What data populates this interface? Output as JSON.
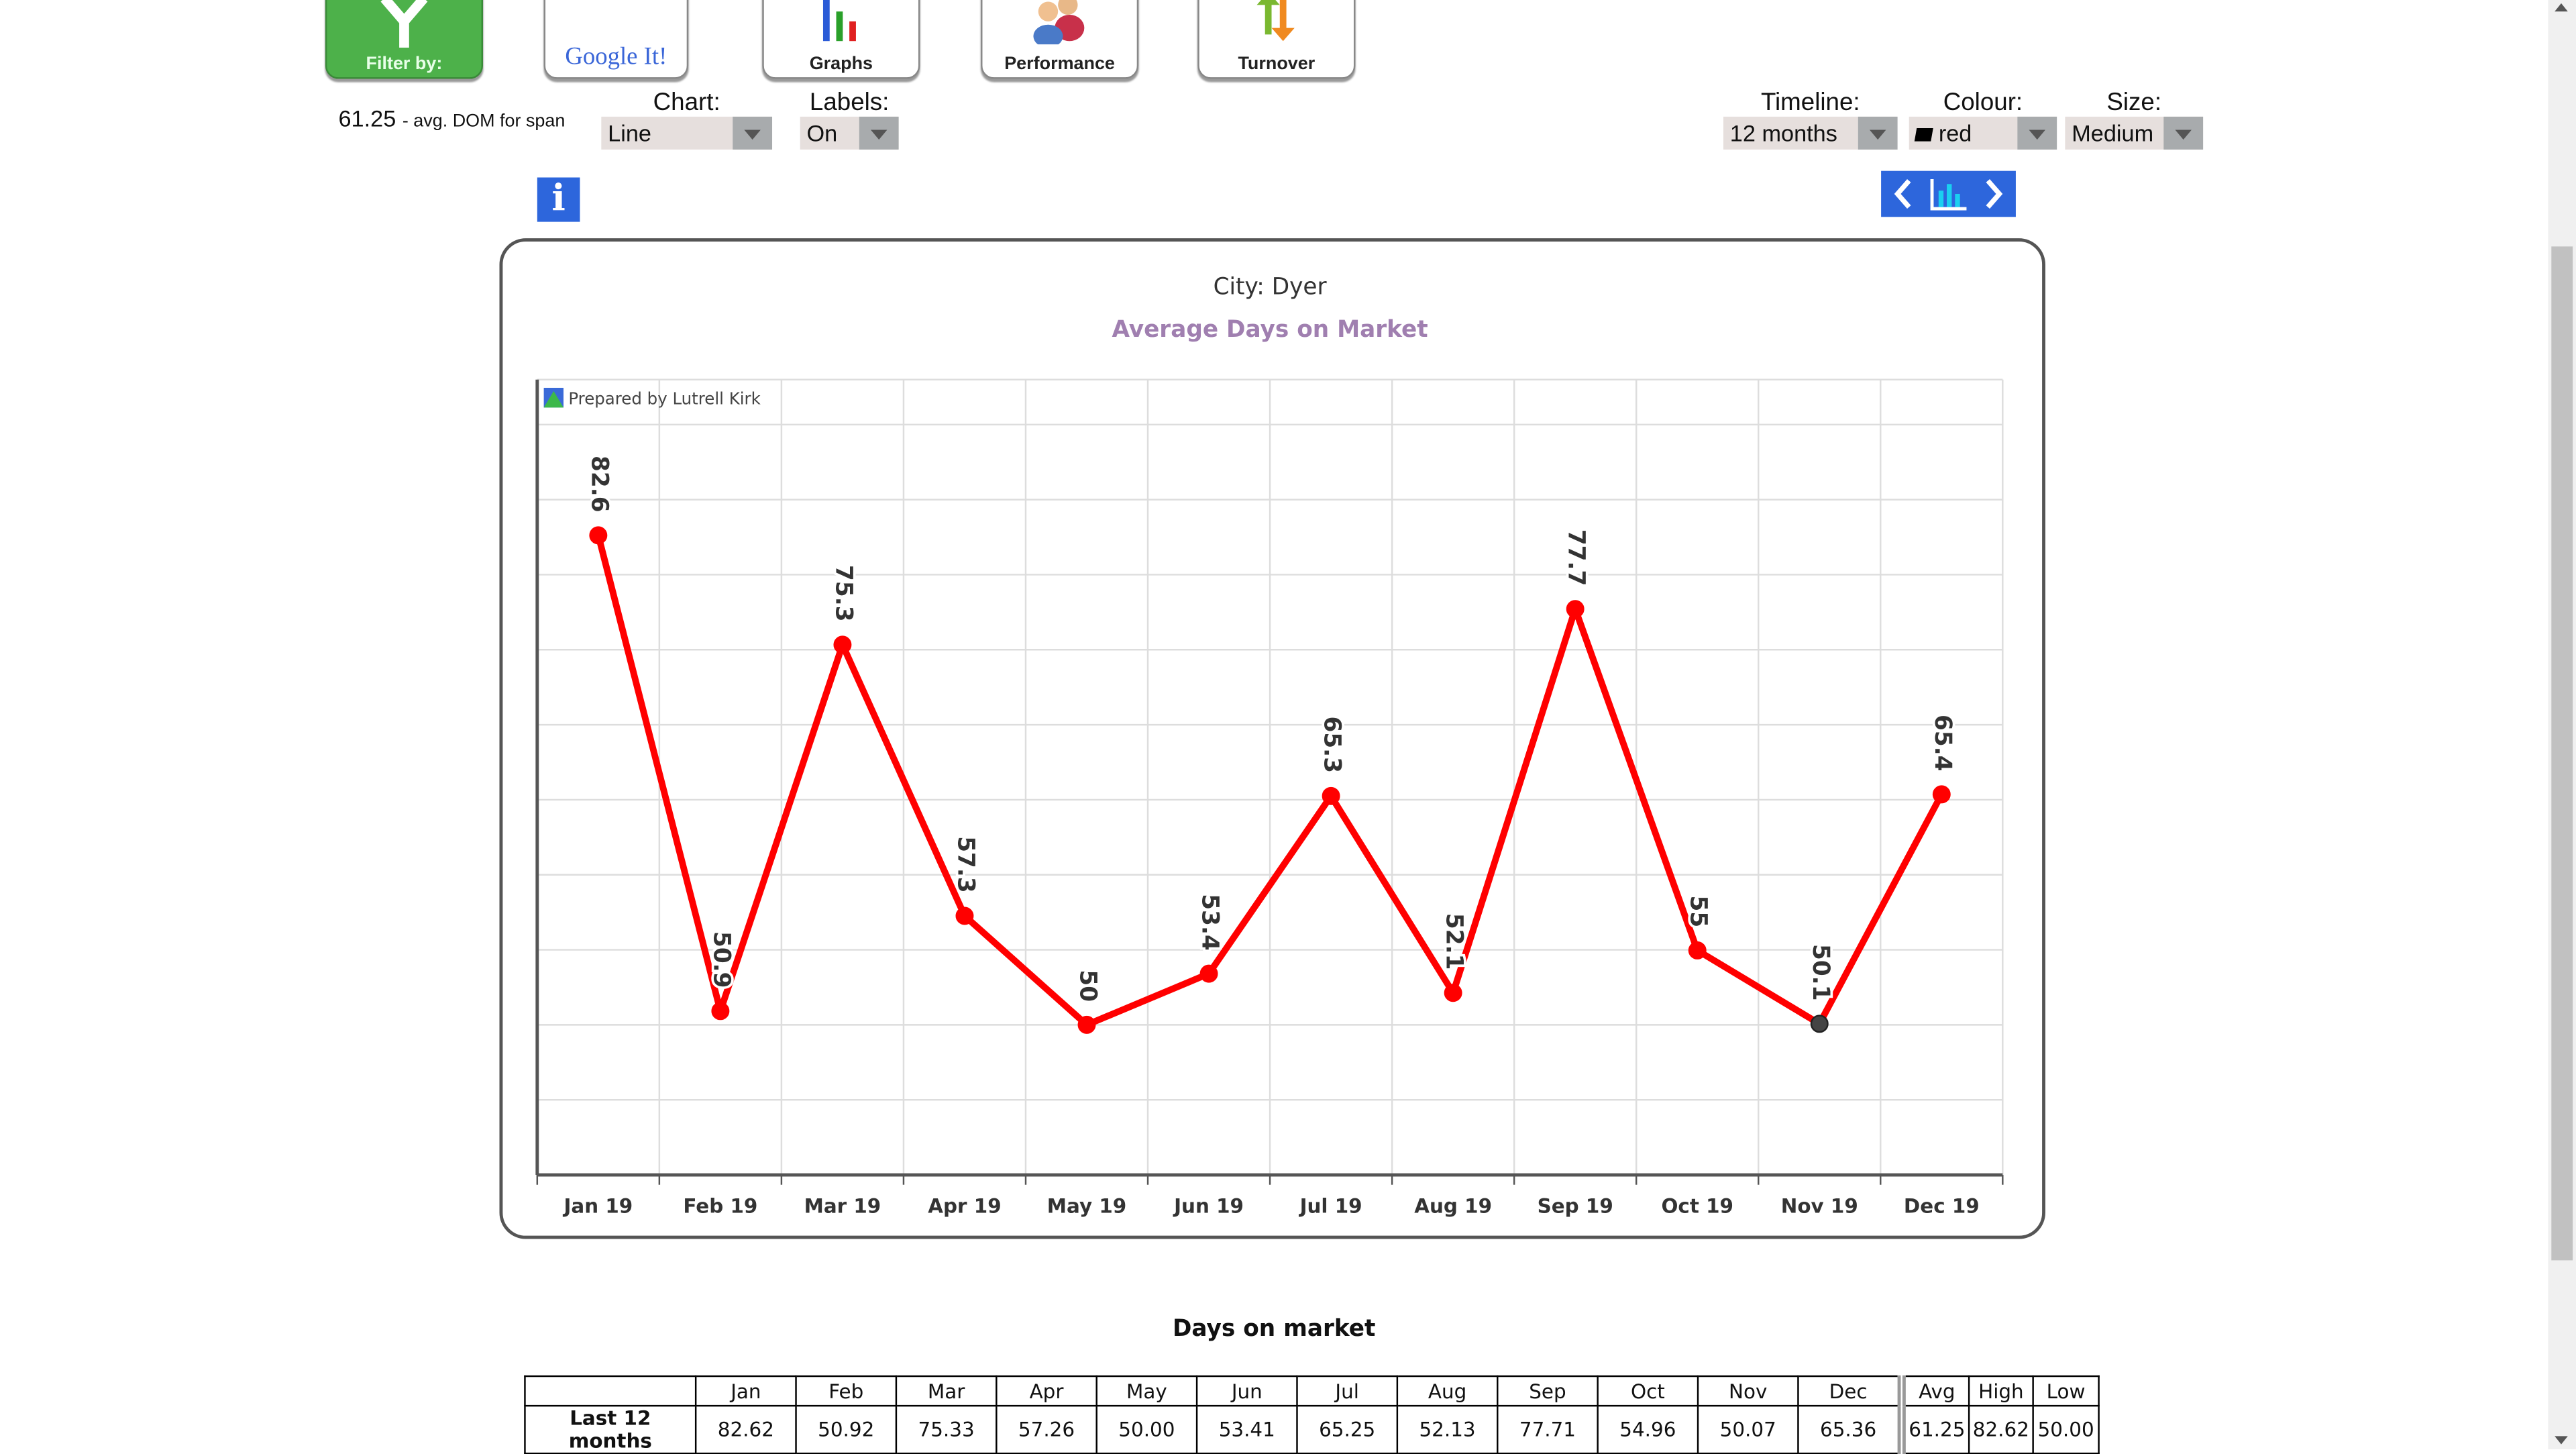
{
  "toolbar": {
    "filter_label": "Filter by:",
    "google_label": "Google It!",
    "graphs_label": "Graphs",
    "performance_label": "Performance",
    "turnover_label": "Turnover"
  },
  "summary": {
    "value": "61.25",
    "text": "- avg. DOM for span"
  },
  "controls": {
    "chart": {
      "label": "Chart:",
      "value": "Line"
    },
    "labels": {
      "label": "Labels:",
      "value": "On"
    },
    "timeline": {
      "label": "Timeline:",
      "value": "12 months"
    },
    "colour": {
      "label": "Colour:",
      "value": "red",
      "swatch": "#000000"
    },
    "size": {
      "label": "Size:",
      "value": "Medium"
    }
  },
  "icons": {
    "info": "info-icon",
    "nav": [
      "chevron-left-icon",
      "bar-chart-icon",
      "chevron-right-icon"
    ]
  },
  "chart_data": {
    "type": "line",
    "title": "City: Dyer",
    "subtitle": "Average Days on Market",
    "credit": "Prepared by Lutrell Kirk",
    "categories": [
      "Jan 19",
      "Feb 19",
      "Mar 19",
      "Apr 19",
      "May 19",
      "Jun 19",
      "Jul 19",
      "Aug 19",
      "Sep 19",
      "Oct 19",
      "Nov 19",
      "Dec 19"
    ],
    "values": [
      82.62,
      50.92,
      75.33,
      57.26,
      50.0,
      53.41,
      65.25,
      52.13,
      77.71,
      54.96,
      50.07,
      65.36
    ],
    "data_labels": [
      "82.6",
      "50.9",
      "75.3",
      "57.3",
      "50",
      "53.4",
      "65.3",
      "52.1",
      "77.7",
      "55",
      "50.1",
      "65.4"
    ],
    "ylim": [
      40,
      93
    ],
    "grid": true,
    "line_color": "#ff0000",
    "highlight_index": 10,
    "highlight_color": "#444444",
    "subtitle_color": "#a07fb0"
  },
  "table": {
    "title": "Days on market",
    "headers": [
      "",
      "Jan",
      "Feb",
      "Mar",
      "Apr",
      "May",
      "Jun",
      "Jul",
      "Aug",
      "Sep",
      "Oct",
      "Nov",
      "Dec",
      "Avg",
      "High",
      "Low"
    ],
    "rows": [
      {
        "label": "Last 12 months",
        "values": [
          "82.62",
          "50.92",
          "75.33",
          "57.26",
          "50.00",
          "53.41",
          "65.25",
          "52.13",
          "77.71",
          "54.96",
          "50.07",
          "65.36",
          "61.25",
          "82.62",
          "50.00"
        ]
      }
    ]
  }
}
